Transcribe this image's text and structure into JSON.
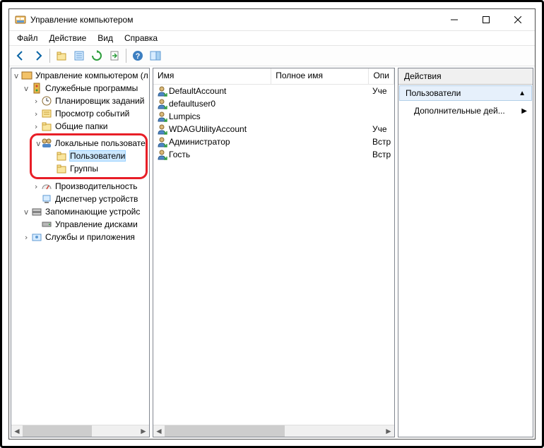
{
  "window": {
    "title": "Управление компьютером"
  },
  "menu": {
    "file": "Файл",
    "action": "Действие",
    "view": "Вид",
    "help": "Справка"
  },
  "tree": {
    "root": "Управление компьютером (л",
    "system_tools": "Служебные программы",
    "task_scheduler": "Планировщик заданий",
    "event_viewer": "Просмотр событий",
    "shared_folders": "Общие папки",
    "local_users_groups": "Локальные пользовате",
    "users": "Пользователи",
    "groups": "Группы",
    "performance": "Производительность",
    "device_manager": "Диспетчер устройств",
    "storage": "Запоминающие устройс",
    "disk_management": "Управление дисками",
    "services_apps": "Службы и приложения"
  },
  "list": {
    "columns": {
      "name": "Имя",
      "full_name": "Полное имя",
      "description": "Опи"
    },
    "rows": [
      {
        "name": "DefaultAccount",
        "full": "",
        "desc": "Уче"
      },
      {
        "name": "defaultuser0",
        "full": "",
        "desc": ""
      },
      {
        "name": "Lumpics",
        "full": "",
        "desc": ""
      },
      {
        "name": "WDAGUtilityAccount",
        "full": "",
        "desc": "Уче"
      },
      {
        "name": "Администратор",
        "full": "",
        "desc": "Встр"
      },
      {
        "name": "Гость",
        "full": "",
        "desc": "Встр"
      }
    ]
  },
  "actions": {
    "header": "Действия",
    "group": "Пользователи",
    "more": "Дополнительные дей..."
  }
}
